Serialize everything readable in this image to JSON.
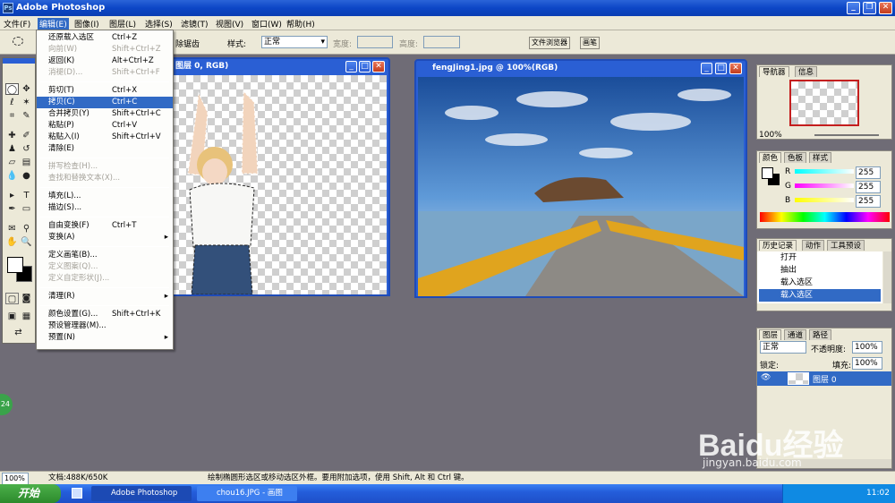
{
  "app": {
    "title": "Adobe Photoshop",
    "ps_icon": "Ps"
  },
  "window_buttons": {
    "minimize": "_",
    "restore": "❐",
    "close": "✕"
  },
  "menubar": {
    "items": [
      "文件(F)",
      "编辑(E)",
      "图像(I)",
      "图层(L)",
      "选择(S)",
      "滤镜(T)",
      "视图(V)",
      "窗口(W)",
      "帮助(H)"
    ]
  },
  "options": {
    "feather_tail": "除锯齿",
    "style_label": "样式:",
    "style_value": "正常",
    "width_label": "宽度:",
    "height_label": "高度:",
    "file_browser_tab": "文件浏览器",
    "brushes_tab": "画笔"
  },
  "edit_menu": {
    "items": [
      {
        "label": "还原载入选区",
        "shortcut": "Ctrl+Z",
        "state": "normal"
      },
      {
        "label": "向前(W)",
        "shortcut": "Shift+Ctrl+Z",
        "state": "disabled"
      },
      {
        "label": "返回(K)",
        "shortcut": "Alt+Ctrl+Z",
        "state": "normal"
      },
      {
        "label": "消褪(D)...",
        "shortcut": "Shift+Ctrl+F",
        "state": "disabled"
      },
      {
        "label": "剪切(T)",
        "shortcut": "Ctrl+X",
        "state": "normal"
      },
      {
        "label": "拷贝(C)",
        "shortcut": "Ctrl+C",
        "state": "highlighted"
      },
      {
        "label": "合并拷贝(Y)",
        "shortcut": "Shift+Ctrl+C",
        "state": "normal"
      },
      {
        "label": "粘贴(P)",
        "shortcut": "Ctrl+V",
        "state": "normal"
      },
      {
        "label": "粘贴入(I)",
        "shortcut": "Shift+Ctrl+V",
        "state": "normal"
      },
      {
        "label": "清除(E)",
        "shortcut": "",
        "state": "normal"
      },
      {
        "label": "拼写检查(H)...",
        "shortcut": "",
        "state": "disabled"
      },
      {
        "label": "查找和替换文本(X)...",
        "shortcut": "",
        "state": "disabled"
      },
      {
        "label": "填充(L)...",
        "shortcut": "",
        "state": "normal"
      },
      {
        "label": "描边(S)...",
        "shortcut": "",
        "state": "normal"
      },
      {
        "label": "自由变换(F)",
        "shortcut": "Ctrl+T",
        "state": "normal"
      },
      {
        "label": "变换(A)",
        "shortcut": "",
        "state": "submenu"
      },
      {
        "label": "定义画笔(B)...",
        "shortcut": "",
        "state": "normal"
      },
      {
        "label": "定义图案(Q)...",
        "shortcut": "",
        "state": "disabled"
      },
      {
        "label": "定义自定形状(J)...",
        "shortcut": "",
        "state": "disabled"
      },
      {
        "label": "清理(R)",
        "shortcut": "",
        "state": "submenu"
      },
      {
        "label": "颜色设置(G)...",
        "shortcut": "Shift+Ctrl+K",
        "state": "normal"
      },
      {
        "label": "预设管理器(M)...",
        "shortcut": "",
        "state": "normal"
      },
      {
        "label": "预置(N)",
        "shortcut": "",
        "state": "submenu"
      }
    ],
    "submenu_arrow": "▸"
  },
  "doc1": {
    "title": "图层 0, RGB)"
  },
  "doc2": {
    "title": "fengJing1.jpg @ 100%(RGB)"
  },
  "navigator": {
    "tab1": "导航器",
    "tab2": "信息",
    "zoom": "100%"
  },
  "color_panel": {
    "tabs": [
      "颜色",
      "色板",
      "样式"
    ],
    "channels": [
      {
        "label": "R",
        "value": "255",
        "color": "#e04040"
      },
      {
        "label": "G",
        "value": "255",
        "color": "#40c040"
      },
      {
        "label": "B",
        "value": "255",
        "color": "#4040e0"
      }
    ]
  },
  "history_panel": {
    "tabs": [
      "历史记录",
      "动作",
      "工具预设"
    ],
    "items": [
      {
        "label": "打开",
        "selected": false
      },
      {
        "label": "抽出",
        "selected": false
      },
      {
        "label": "载入选区",
        "selected": false
      },
      {
        "label": "载入选区",
        "selected": true
      }
    ]
  },
  "layers_panel": {
    "tabs": [
      "图层",
      "通道",
      "路径"
    ],
    "blend_mode": "正常",
    "opacity_label": "不透明度:",
    "opacity_value": "100%",
    "lock_label": "锁定:",
    "fill_label": "填充:",
    "fill_value": "100%",
    "layer_name": "图层 0"
  },
  "statusbar": {
    "zoom": "100%",
    "doc_info": "文档:488K/650K",
    "hint": "绘制椭圆形选区或移动选区外框。要用附加选项，使用 Shift, Alt 和 Ctrl 键。"
  },
  "taskbar": {
    "start": "开始",
    "tasks": [
      "Adobe Photoshop",
      "chou16.JPG - 画图"
    ],
    "time": "11:02"
  },
  "watermark": {
    "brand": "Baidu经验",
    "url": "jingyan.baidu.com"
  },
  "badge": "24",
  "colors": {
    "accent": "#316ac5",
    "titlebar": "#0c46c6",
    "workspace": "#6f6c76"
  }
}
